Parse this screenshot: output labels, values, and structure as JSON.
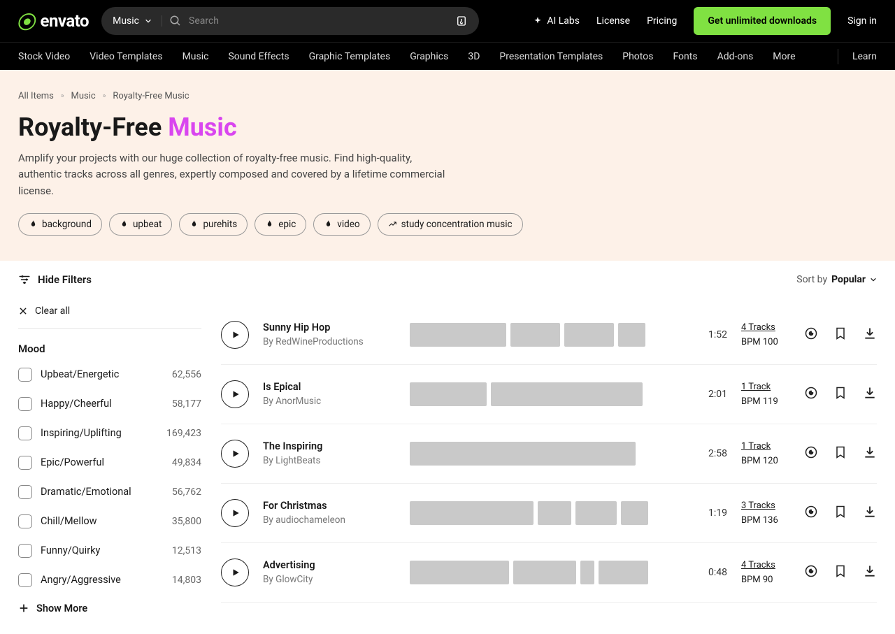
{
  "header": {
    "brand": "envato",
    "search_category": "Music",
    "search_placeholder": "Search",
    "ai_labs": "AI Labs",
    "license": "License",
    "pricing": "Pricing",
    "cta": "Get unlimited downloads",
    "sign_in": "Sign in",
    "nav": [
      "Stock Video",
      "Video Templates",
      "Music",
      "Sound Effects",
      "Graphic Templates",
      "Graphics",
      "3D",
      "Presentation Templates",
      "Photos",
      "Fonts",
      "Add-ons",
      "More"
    ],
    "learn": "Learn"
  },
  "breadcrumbs": [
    "All Items",
    "Music",
    "Royalty-Free Music"
  ],
  "hero": {
    "title_a": "Royalty-Free ",
    "title_b": "Music",
    "subtitle": "Amplify your projects with our huge collection of royalty-free music. Find high-quality, authentic tracks across all genres, expertly composed and covered by a lifetime commercial license.",
    "pills": [
      {
        "icon": "flame",
        "label": "background"
      },
      {
        "icon": "flame",
        "label": "upbeat"
      },
      {
        "icon": "flame",
        "label": "purehits"
      },
      {
        "icon": "flame",
        "label": "epic"
      },
      {
        "icon": "flame",
        "label": "video"
      },
      {
        "icon": "trend",
        "label": "study concentration music"
      }
    ]
  },
  "toolbar": {
    "hide_filters": "Hide Filters",
    "sort_label": "Sort by",
    "sort_value": "Popular"
  },
  "filters": {
    "clear": "Clear all",
    "group_title": "Mood",
    "options": [
      {
        "label": "Upbeat/Energetic",
        "count": "62,556"
      },
      {
        "label": "Happy/Cheerful",
        "count": "58,177"
      },
      {
        "label": "Inspiring/Uplifting",
        "count": "169,423"
      },
      {
        "label": "Epic/Powerful",
        "count": "49,834"
      },
      {
        "label": "Dramatic/Emotional",
        "count": "56,762"
      },
      {
        "label": "Chill/Mellow",
        "count": "35,800"
      },
      {
        "label": "Funny/Quirky",
        "count": "12,513"
      },
      {
        "label": "Angry/Aggressive",
        "count": "14,803"
      }
    ],
    "show_more": "Show More"
  },
  "tracks": [
    {
      "title": "Sunny Hip Hop",
      "author": "By RedWineProductions",
      "duration": "1:52",
      "tracks_label": "4 Tracks",
      "bpm": "BPM 100",
      "segs": [
        35,
        18,
        18,
        10
      ]
    },
    {
      "title": "Is Epical",
      "author": "By AnorMusic",
      "duration": "2:01",
      "tracks_label": "1 Track",
      "bpm": "BPM 119",
      "segs": [
        28,
        55
      ]
    },
    {
      "title": "The Inspiring",
      "author": "By LightBeats",
      "duration": "2:58",
      "tracks_label": "1 Track",
      "bpm": "BPM 120",
      "segs": [
        82
      ]
    },
    {
      "title": "For Christmas",
      "author": "By audiochameleon",
      "duration": "1:19",
      "tracks_label": "3 Tracks",
      "bpm": "BPM 136",
      "segs": [
        45,
        12,
        15,
        10
      ]
    },
    {
      "title": "Advertising",
      "author": "By GlowCity",
      "duration": "0:48",
      "tracks_label": "4 Tracks",
      "bpm": "BPM 90",
      "segs": [
        36,
        23,
        5,
        18
      ]
    }
  ]
}
